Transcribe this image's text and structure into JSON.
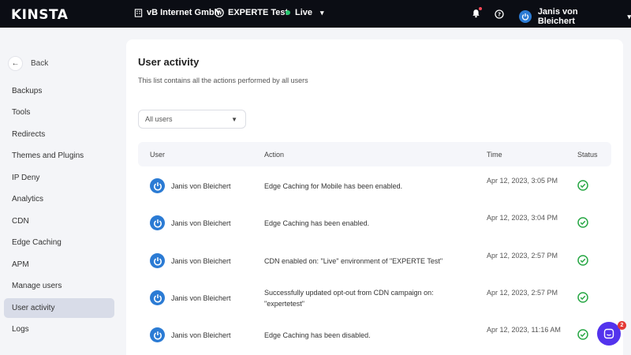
{
  "topbar": {
    "logo": "KINSTA",
    "company": "vB Internet Gmbh",
    "site": "EXPERTE Test",
    "environment": "Live",
    "user_name": "Janis von Bleichert"
  },
  "sidebar": {
    "back_label": "Back",
    "items": [
      {
        "label": "Backups"
      },
      {
        "label": "Tools"
      },
      {
        "label": "Redirects"
      },
      {
        "label": "Themes and Plugins"
      },
      {
        "label": "IP Deny"
      },
      {
        "label": "Analytics"
      },
      {
        "label": "CDN"
      },
      {
        "label": "Edge Caching"
      },
      {
        "label": "APM"
      },
      {
        "label": "Manage users"
      },
      {
        "label": "User activity",
        "active": true
      },
      {
        "label": "Logs"
      }
    ]
  },
  "main": {
    "title": "User activity",
    "subtitle": "This list contains all the actions performed by all users",
    "filter": {
      "selected": "All users"
    },
    "columns": {
      "user": "User",
      "action": "Action",
      "time": "Time",
      "status": "Status"
    },
    "rows": [
      {
        "user": "Janis von Bleichert",
        "action": "Edge Caching for Mobile has been enabled.",
        "time": "Apr 12, 2023, 3:05 PM",
        "status": "success"
      },
      {
        "user": "Janis von Bleichert",
        "action": "Edge Caching has been enabled.",
        "time": "Apr 12, 2023, 3:04 PM",
        "status": "success"
      },
      {
        "user": "Janis von Bleichert",
        "action": "CDN enabled on: \"Live\" environment of \"EXPERTE Test\"",
        "time": "Apr 12, 2023, 2:57 PM",
        "status": "success"
      },
      {
        "user": "Janis von Bleichert",
        "action": "Successfully updated opt-out from CDN campaign on: \"expertetest\"",
        "time": "Apr 12, 2023, 2:57 PM",
        "status": "success"
      },
      {
        "user": "Janis von Bleichert",
        "action": "Edge Caching has been disabled.",
        "time": "Apr 12, 2023, 11:16 AM",
        "status": "success"
      }
    ]
  },
  "chat": {
    "badge_count": "2"
  },
  "colors": {
    "topbar": "#0b0d14",
    "accent": "#5333ed",
    "success": "#28a745",
    "avatar": "#2b7bd4",
    "live": "#28c76f"
  }
}
